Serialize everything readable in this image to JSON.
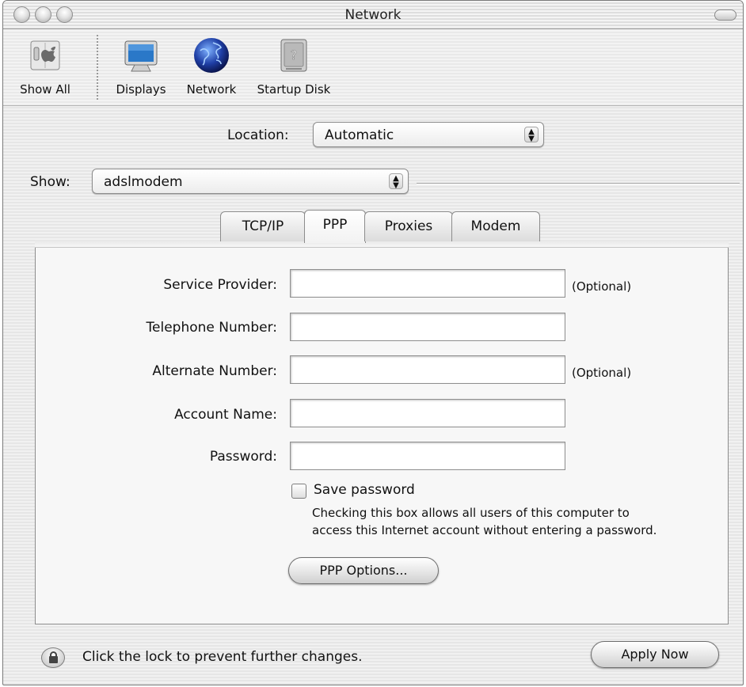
{
  "window": {
    "title": "Network"
  },
  "toolbar": {
    "items": [
      {
        "label": "Show All",
        "icon": "apple-switch-icon"
      },
      {
        "label": "Displays",
        "icon": "monitor-icon"
      },
      {
        "label": "Network",
        "icon": "globe-icon"
      },
      {
        "label": "Startup Disk",
        "icon": "hard-disk-icon"
      }
    ]
  },
  "location": {
    "label": "Location:",
    "value": "Automatic"
  },
  "show": {
    "label": "Show:",
    "value": "adslmodem"
  },
  "tabs": [
    {
      "label": "TCP/IP",
      "selected": false
    },
    {
      "label": "PPP",
      "selected": true
    },
    {
      "label": "Proxies",
      "selected": false
    },
    {
      "label": "Modem",
      "selected": false
    }
  ],
  "ppp": {
    "fields": [
      {
        "label": "Service Provider:",
        "value": "",
        "note": "(Optional)"
      },
      {
        "label": "Telephone Number:",
        "value": "",
        "note": ""
      },
      {
        "label": "Alternate Number:",
        "value": "",
        "note": "(Optional)"
      },
      {
        "label": "Account Name:",
        "value": "",
        "note": ""
      },
      {
        "label": "Password:",
        "value": "",
        "note": ""
      }
    ],
    "save_password": {
      "label": "Save password",
      "checked": false,
      "help_line1": "Checking this box allows all users of this computer to",
      "help_line2": "access this Internet account without entering a password."
    },
    "options_button": "PPP Options..."
  },
  "footer": {
    "lock_text": "Click the lock to prevent further changes.",
    "apply_button": "Apply Now"
  }
}
